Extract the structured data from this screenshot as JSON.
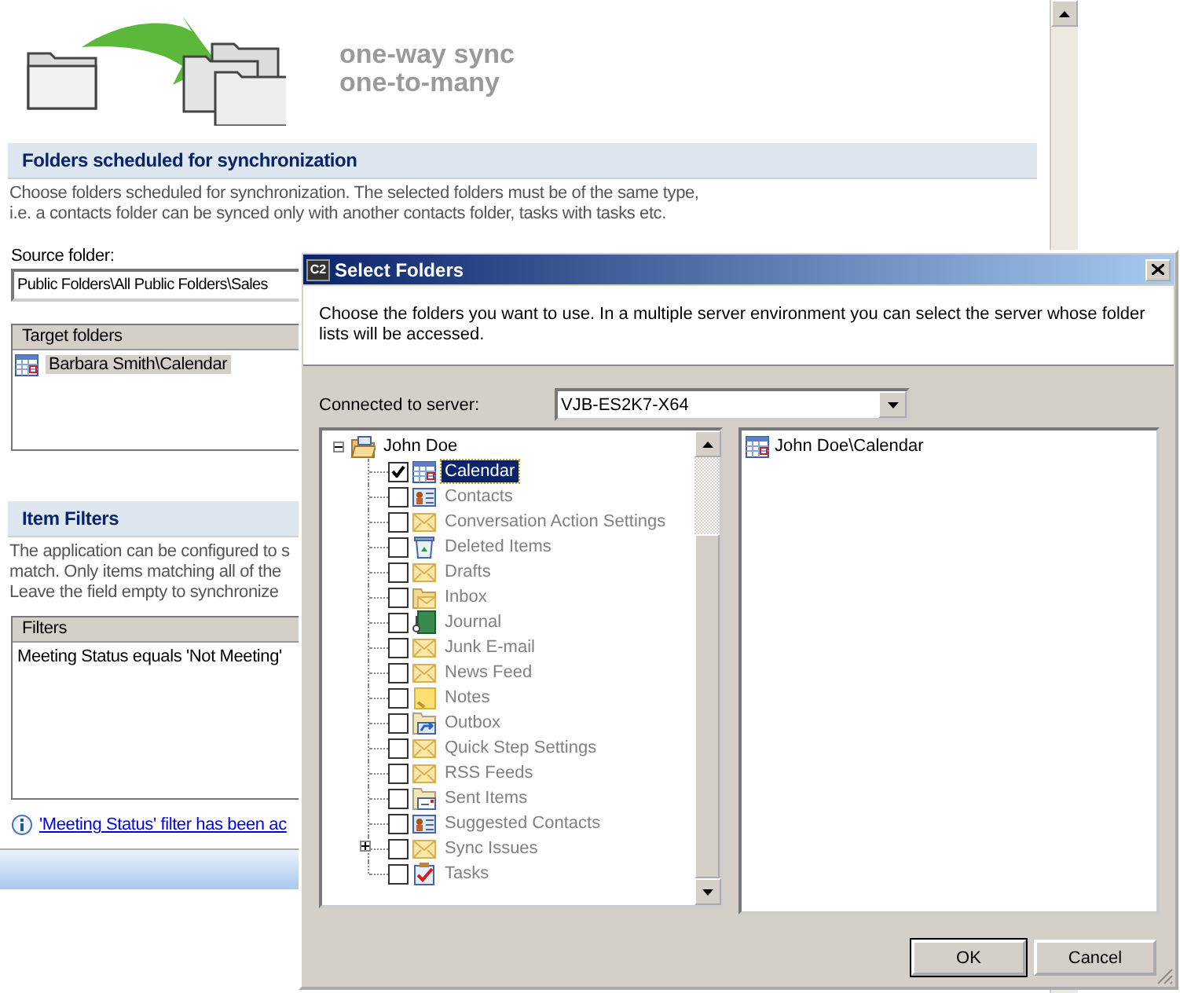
{
  "header": {
    "tagline": [
      "one-way sync",
      "one-to-many"
    ]
  },
  "folders_section": {
    "title": "Folders scheduled for synchronization",
    "description": [
      "Choose folders scheduled for synchronization. The selected folders must be of the same type,",
      "i.e. a contacts folder can be synced only with another contacts folder, tasks with tasks etc."
    ],
    "source_label": "Source folder:",
    "source_value": "Public Folders\\All Public Folders\\Sales",
    "target_list": {
      "column": "Target folders",
      "rows": [
        {
          "text": "Barbara Smith\\Calendar",
          "selected": true
        }
      ]
    }
  },
  "filters_section": {
    "title": "Item Filters",
    "description": [
      "The application can be configured to s",
      "match. Only items matching all of the",
      "Leave the field empty to synchronize"
    ],
    "filter_list": {
      "column": "Filters",
      "rows": [
        {
          "text": "Meeting Status equals 'Not Meeting'",
          "selected": false
        }
      ]
    },
    "info_link": "'Meeting Status' filter has been ac"
  },
  "dialog": {
    "icon_label": "C2",
    "title": "Select Folders",
    "intro": "Choose the folders you want to use. In a multiple server environment you can select the server whose folder lists will be accessed.",
    "server_label": "Connected to server:",
    "server_value": "VJB-ES2K7-X64",
    "tree": [
      {
        "label": "John Doe",
        "kind": "mailbox",
        "expanded": true,
        "children": [
          {
            "label": "Calendar",
            "kind": "calendar",
            "checked": true,
            "disabled": false,
            "selected": true
          },
          {
            "label": "Contacts",
            "kind": "contacts",
            "checked": false,
            "disabled": true,
            "selected": false
          },
          {
            "label": "Conversation Action Settings",
            "kind": "mail",
            "checked": false,
            "disabled": true,
            "selected": false
          },
          {
            "label": "Deleted Items",
            "kind": "deleted",
            "checked": false,
            "disabled": true,
            "selected": false
          },
          {
            "label": "Drafts",
            "kind": "mail",
            "checked": false,
            "disabled": true,
            "selected": false
          },
          {
            "label": "Inbox",
            "kind": "inbox",
            "checked": false,
            "disabled": true,
            "selected": false
          },
          {
            "label": "Journal",
            "kind": "journal",
            "checked": false,
            "disabled": true,
            "selected": false
          },
          {
            "label": "Junk E-mail",
            "kind": "mail",
            "checked": false,
            "disabled": true,
            "selected": false
          },
          {
            "label": "News Feed",
            "kind": "mail",
            "checked": false,
            "disabled": true,
            "selected": false
          },
          {
            "label": "Notes",
            "kind": "notes",
            "checked": false,
            "disabled": true,
            "selected": false
          },
          {
            "label": "Outbox",
            "kind": "outbox",
            "checked": false,
            "disabled": true,
            "selected": false
          },
          {
            "label": "Quick Step Settings",
            "kind": "mail",
            "checked": false,
            "disabled": true,
            "selected": false
          },
          {
            "label": "RSS Feeds",
            "kind": "mail",
            "checked": false,
            "disabled": true,
            "selected": false
          },
          {
            "label": "Sent Items",
            "kind": "sent",
            "checked": false,
            "disabled": true,
            "selected": false
          },
          {
            "label": "Suggested Contacts",
            "kind": "contacts",
            "checked": false,
            "disabled": true,
            "selected": false
          },
          {
            "label": "Sync Issues",
            "kind": "mail",
            "checked": false,
            "disabled": true,
            "selected": false,
            "expanded": false
          },
          {
            "label": "Tasks",
            "kind": "tasks",
            "checked": false,
            "disabled": true,
            "selected": false
          }
        ]
      }
    ],
    "chosen": [
      {
        "text": "John Doe\\Calendar",
        "kind": "calendar"
      }
    ],
    "buttons": [
      {
        "label": "OK",
        "default": true
      },
      {
        "label": "Cancel",
        "default": false
      }
    ]
  }
}
